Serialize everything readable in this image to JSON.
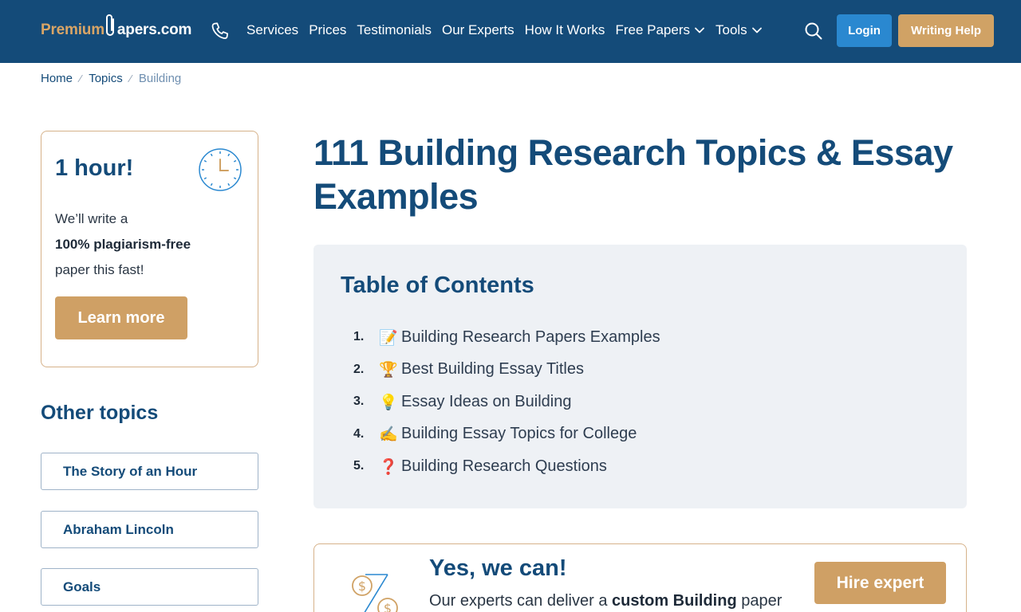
{
  "header": {
    "logo_part1": "Premium",
    "logo_part2": "apers.com",
    "phone_icon": "phone-icon",
    "nav": [
      {
        "label": "Services",
        "dropdown": false
      },
      {
        "label": "Prices",
        "dropdown": false
      },
      {
        "label": "Testimonials",
        "dropdown": false
      },
      {
        "label": "Our Experts",
        "dropdown": false
      },
      {
        "label": "How It Works",
        "dropdown": false
      },
      {
        "label": "Free Papers",
        "dropdown": true
      },
      {
        "label": "Tools",
        "dropdown": true
      }
    ],
    "search_icon": "search-icon",
    "login_label": "Login",
    "writing_help_label": "Writing Help",
    "colors": {
      "bar": "#144b79",
      "login": "#2a88d0",
      "accent": "#d0a265"
    }
  },
  "breadcrumb": {
    "items": [
      "Home",
      "Topics"
    ],
    "current": "Building"
  },
  "promo": {
    "title": "1 hour!",
    "line1": "We’ll write a",
    "line2": "100% plagiarism-free",
    "line3": "paper this fast!",
    "button": "Learn more"
  },
  "other_topics": {
    "title": "Other topics",
    "items": [
      "The Story of an Hour",
      "Abraham Lincoln",
      "Goals"
    ]
  },
  "main": {
    "title": "111 Building Research Topics & Essay Examples"
  },
  "toc": {
    "title": "Table of Contents",
    "items": [
      {
        "num": "1.",
        "emoji": "📝",
        "label": "Building Research Papers Examples"
      },
      {
        "num": "2.",
        "emoji": "🏆",
        "label": "Best Building Essay Titles"
      },
      {
        "num": "3.",
        "emoji": "💡",
        "label": "Essay Ideas on Building"
      },
      {
        "num": "4.",
        "emoji": "✍️",
        "label": "Building Essay Topics for College"
      },
      {
        "num": "5.",
        "emoji": "❓",
        "label": "Building Research Questions"
      }
    ]
  },
  "cta": {
    "title": "Yes, we can!",
    "text_before": "Our experts can deliver a ",
    "text_bold": "custom Building",
    "text_after": " paper",
    "button": "Hire expert"
  }
}
